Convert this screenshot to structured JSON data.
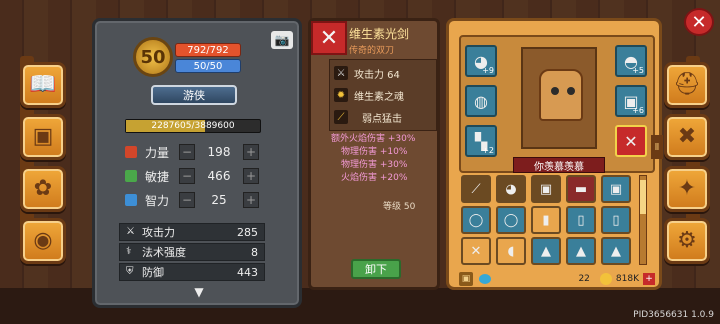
{
  "close_button": {
    "icon": "close-icon",
    "glyph": "✕"
  },
  "left_nav": [
    {
      "name": "book-icon",
      "glyph": "📖"
    },
    {
      "name": "chest-icon",
      "glyph": "▣"
    },
    {
      "name": "paw-icon",
      "glyph": "✿"
    },
    {
      "name": "wheel-icon",
      "glyph": "◉"
    }
  ],
  "right_nav": [
    {
      "name": "helmet-icon",
      "glyph": "⛑"
    },
    {
      "name": "skills-icon",
      "glyph": "✖"
    },
    {
      "name": "star-icon",
      "glyph": "✦"
    },
    {
      "name": "settings-icon",
      "glyph": "⚙"
    }
  ],
  "character": {
    "level": "50",
    "hp": "792/792",
    "mp": "50/50",
    "class": "游侠",
    "xp": "2287605/3889600",
    "xp_fraction": 0.588,
    "camera_glyph": "📷",
    "attributes": [
      {
        "name": "力量",
        "value": "198",
        "color": "#d2462a"
      },
      {
        "name": "敏捷",
        "value": "466",
        "color": "#4aa84a"
      },
      {
        "name": "智力",
        "value": "25",
        "color": "#3d8fd6"
      }
    ],
    "derived": [
      {
        "name": "攻击力",
        "value": "285",
        "glyph": "⚔"
      },
      {
        "name": "法术强度",
        "value": "8",
        "glyph": "⚕"
      },
      {
        "name": "防御",
        "value": "443",
        "glyph": "⛨"
      }
    ],
    "more_glyph": "▼"
  },
  "item": {
    "name": "维生素光剑",
    "type": "传奇的双刀",
    "icon_glyph": "✕",
    "stats": [
      {
        "text": "攻击力 64",
        "glyph": "⚔",
        "color": "#cfcfcf"
      },
      {
        "text": "维生素之魂",
        "glyph": "✹",
        "color": "#f2c23a"
      },
      {
        "text": "弱点猛击",
        "glyph": "⟋",
        "color": "#f2c23a"
      }
    ],
    "bonuses": [
      "额外火焰伤害 +30%",
      "物理伤害 +10%",
      "物理伤害 +30%",
      "火焰伤害 +20%"
    ],
    "level_label": "等级 50",
    "unequip_label": "卸下"
  },
  "equipment": {
    "pet_name": "你羡慕羡慕",
    "arrow_glyph": "Ⅱ",
    "slots": [
      {
        "name": "helmet-slot",
        "glyph": "◕",
        "badge": "+9"
      },
      {
        "name": "amulet-slot",
        "glyph": "◍",
        "badge": ""
      },
      {
        "name": "gloves-slot",
        "glyph": "▚",
        "badge": "+2"
      },
      {
        "name": "armor-slot",
        "glyph": "◓",
        "badge": "+5"
      },
      {
        "name": "boots-slot",
        "glyph": "▣",
        "badge": "+6"
      },
      {
        "name": "weapon-slot",
        "glyph": "✕",
        "badge": ""
      }
    ]
  },
  "inventory": {
    "slots": [
      {
        "glyph": "⟋",
        "bg": "#6b4a22"
      },
      {
        "glyph": "◕",
        "bg": "#6b4a22"
      },
      {
        "glyph": "▣",
        "bg": "#6b4a22"
      },
      {
        "glyph": "▬",
        "bg": "#8a2a2a"
      },
      {
        "glyph": "▣",
        "bg": "#3a7f9a"
      },
      {
        "glyph": "◯",
        "bg": "#3a7f9a"
      },
      {
        "glyph": "◯",
        "bg": "#3a7f9a"
      },
      {
        "glyph": "▮",
        "bg": "#e9a64d"
      },
      {
        "glyph": "▯",
        "bg": "#3a7f9a"
      },
      {
        "glyph": "▯",
        "bg": "#3a7f9a"
      },
      {
        "glyph": "✕",
        "bg": "#e9a64d"
      },
      {
        "glyph": "◖",
        "bg": "#e9a64d"
      },
      {
        "glyph": "▲",
        "bg": "#3a7f9a"
      },
      {
        "glyph": "▲",
        "bg": "#3a7f9a"
      },
      {
        "glyph": "▲",
        "bg": "#3a7f9a"
      }
    ],
    "gems": "22",
    "gold": "818K",
    "lock_glyph": "▣",
    "plus_glyph": "+"
  },
  "build_id": "PID3656631 1.0.9"
}
